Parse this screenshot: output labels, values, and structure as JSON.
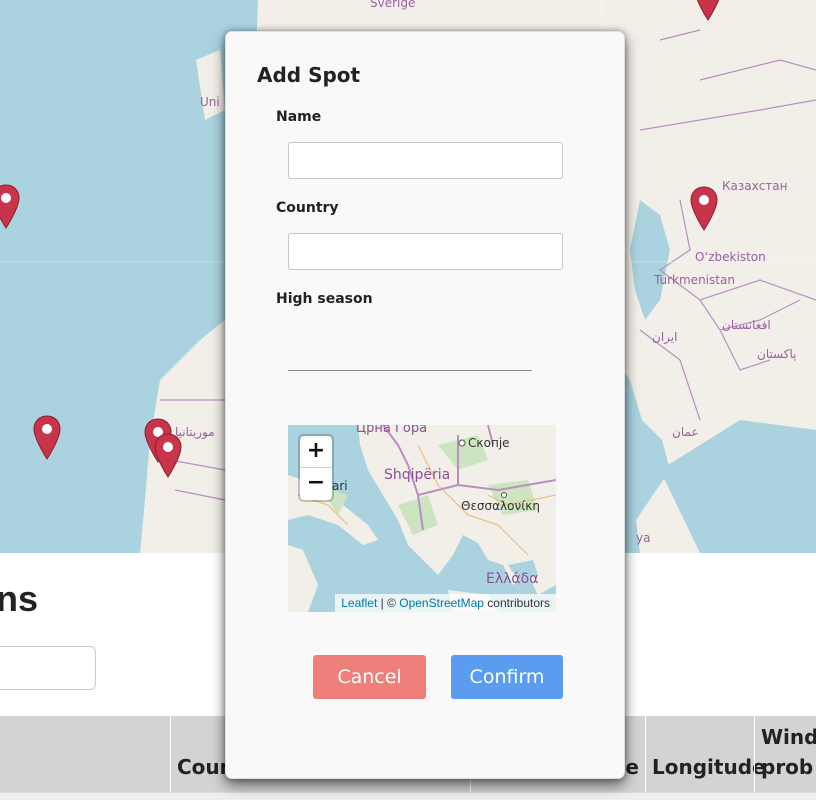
{
  "background_map": {
    "labels": {
      "sverige": "Sverige",
      "uni": "Uni",
      "kazakhstan": "Казахстан",
      "uzbekistan": "O‘zbekiston",
      "turkmenistan": "Turkmenistan",
      "afghanistan": "افغانستان",
      "iran": "ایران",
      "pakistan": "پاکستان",
      "oman": "عمان",
      "mauritania": "موريتانيا",
      "ya": "ya"
    }
  },
  "page": {
    "title": "ns",
    "table_headers": [
      "",
      "Coun",
      "e",
      "Longitude",
      "Wind prob"
    ]
  },
  "modal": {
    "title": "Add Spot",
    "fields": {
      "name": {
        "label": "Name",
        "value": ""
      },
      "country": {
        "label": "Country",
        "value": ""
      },
      "season": {
        "label": "High season",
        "value": ""
      }
    },
    "mini_map": {
      "labels": {
        "crna_gora": "Црна Гора",
        "skopje": "Скопје",
        "shqiperia": "Shqipëria",
        "thessaloniki": "Θεσσαλονίκη",
        "bari": "ari",
        "ellada": "Ελλάδα"
      },
      "zoom_in": "+",
      "zoom_out": "−",
      "attribution": {
        "leaflet": "Leaflet",
        "sep": " | © ",
        "osm": "OpenStreetMap",
        "contributors": " contributors"
      }
    },
    "buttons": {
      "cancel": "Cancel",
      "confirm": "Confirm"
    }
  },
  "colors": {
    "sea": "#aad3df",
    "land": "#f2efe9",
    "border": "#b88fc0",
    "marker": "#c8344a",
    "cancel": "#ef7f7a",
    "confirm": "#5a9cef"
  }
}
